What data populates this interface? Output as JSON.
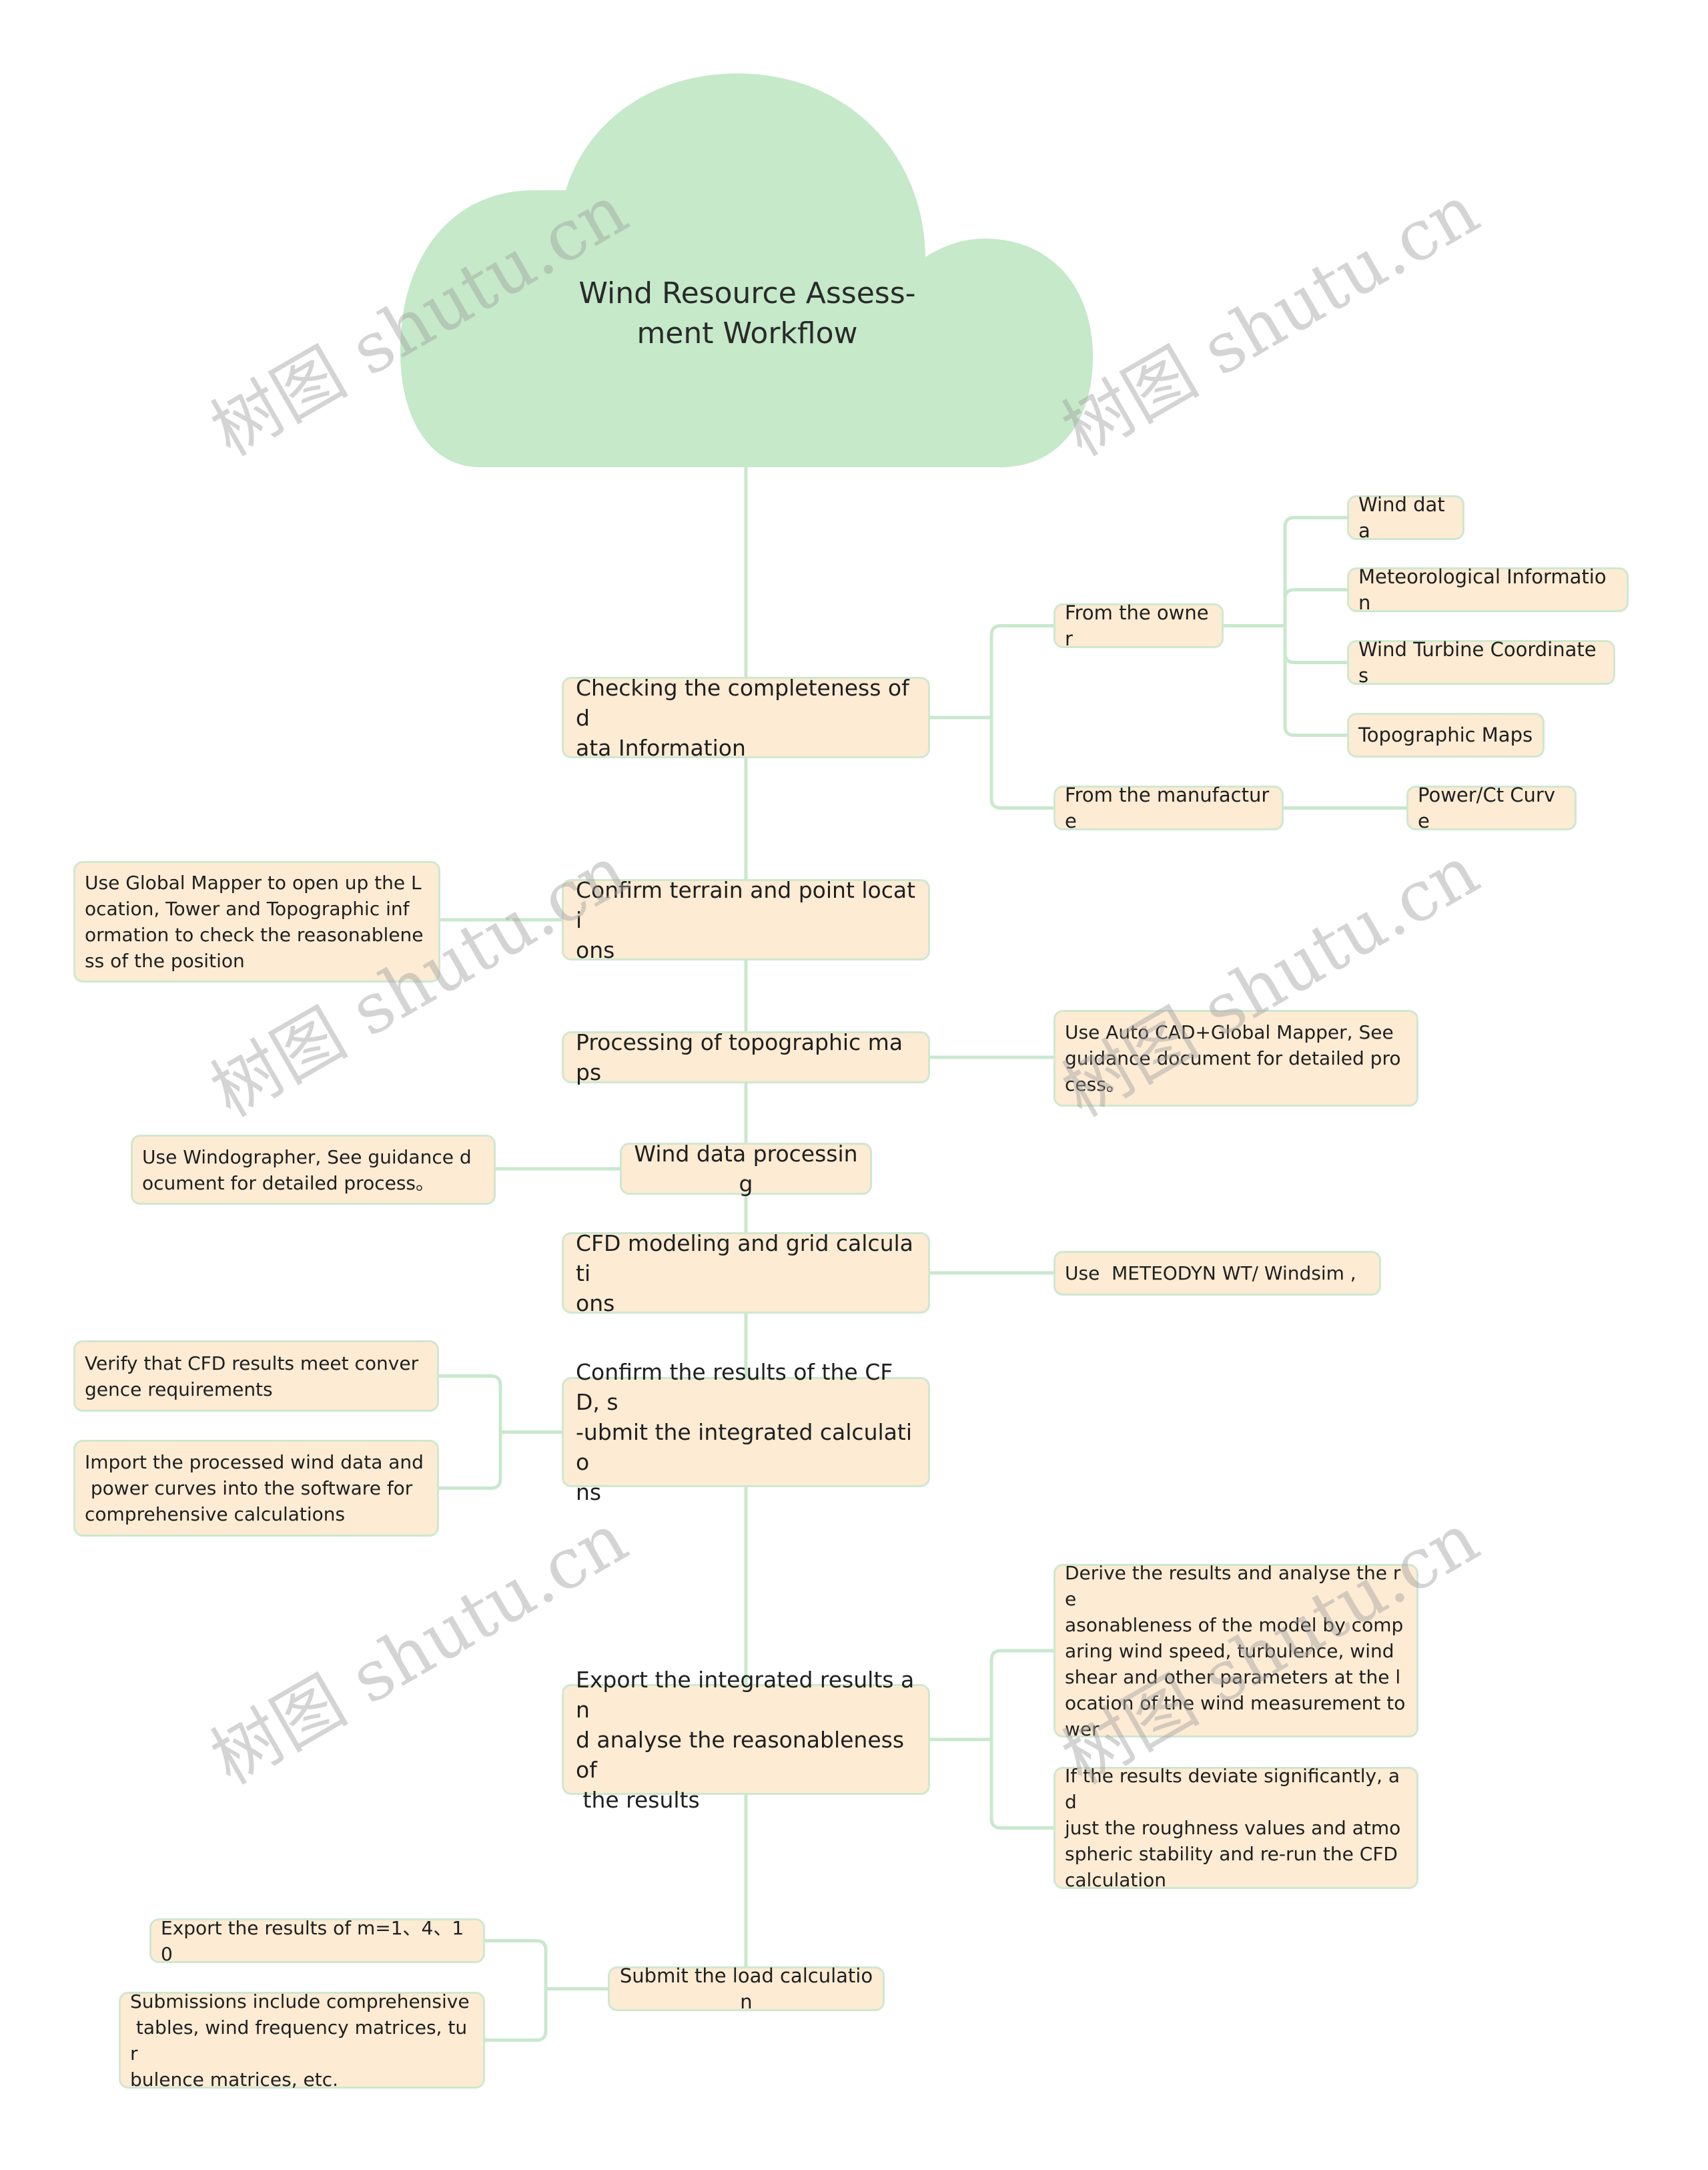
{
  "root": {
    "title": "Wind Resource Assess-\nment Workflow"
  },
  "colors": {
    "cloud": "#c5e9c9",
    "node_fill": "#fdebd4",
    "node_border": "#cfe8cf",
    "connector": "#c9e8cd",
    "text": "#1f1f1f"
  },
  "watermark": "树图 shutu.cn",
  "steps": [
    {
      "label": "Checking the completeness of d\nata Information",
      "children": [
        {
          "label": "From the owner",
          "children": [
            {
              "label": "Wind data"
            },
            {
              "label": "Meteorological Information"
            },
            {
              "label": "Wind Turbine Coordinates"
            },
            {
              "label": "Topographic Maps"
            }
          ]
        },
        {
          "label": "From the manufacture",
          "children": [
            {
              "label": "Power/Ct Curve"
            }
          ]
        }
      ]
    },
    {
      "label": "Confirm terrain and point locati\nons",
      "children": [
        {
          "label": "Use Global Mapper to open up the L\nocation, Tower and Topographic inf\normation to check the reasonablene\nss of the position"
        }
      ]
    },
    {
      "label": "Processing of topographic maps",
      "children": [
        {
          "label": "Use Auto CAD+Global Mapper, See\nguidance document for detailed pro\ncess。"
        }
      ]
    },
    {
      "label": "Wind data processing",
      "children": [
        {
          "label": "Use Windographer, See guidance d\nocument for detailed process。"
        }
      ]
    },
    {
      "label": "CFD modeling and grid calculati\nons",
      "children": [
        {
          "label": "Use  METEODYN WT/ Windsim ,"
        }
      ]
    },
    {
      "label": "Confirm the results of the CFD, s\n-ubmit the integrated calculatio\nns",
      "children": [
        {
          "label": "Verify that CFD results meet conver\ngence requirements"
        },
        {
          "label": "Import the processed wind data and\n power curves into the software for\ncomprehensive calculations"
        }
      ]
    },
    {
      "label": "Export the integrated results an\nd analyse the reasonableness of\n the results",
      "children": [
        {
          "label": "Derive the results and analyse the re\nasonableness of the model by comp\naring wind speed, turbulence, wind\nshear and other parameters at the l\nocation of the wind measurement to\nwer"
        },
        {
          "label": "If the results deviate significantly, ad\njust the roughness values and atmo\nspheric stability and re-run the CFD\ncalculation"
        }
      ]
    },
    {
      "label": "Submit the load calculation",
      "children": [
        {
          "label": "Export the results of m=1、4、10"
        },
        {
          "label": "Submissions include comprehensive\n tables, wind frequency matrices, tur\nbulence matrices, etc."
        }
      ]
    }
  ]
}
